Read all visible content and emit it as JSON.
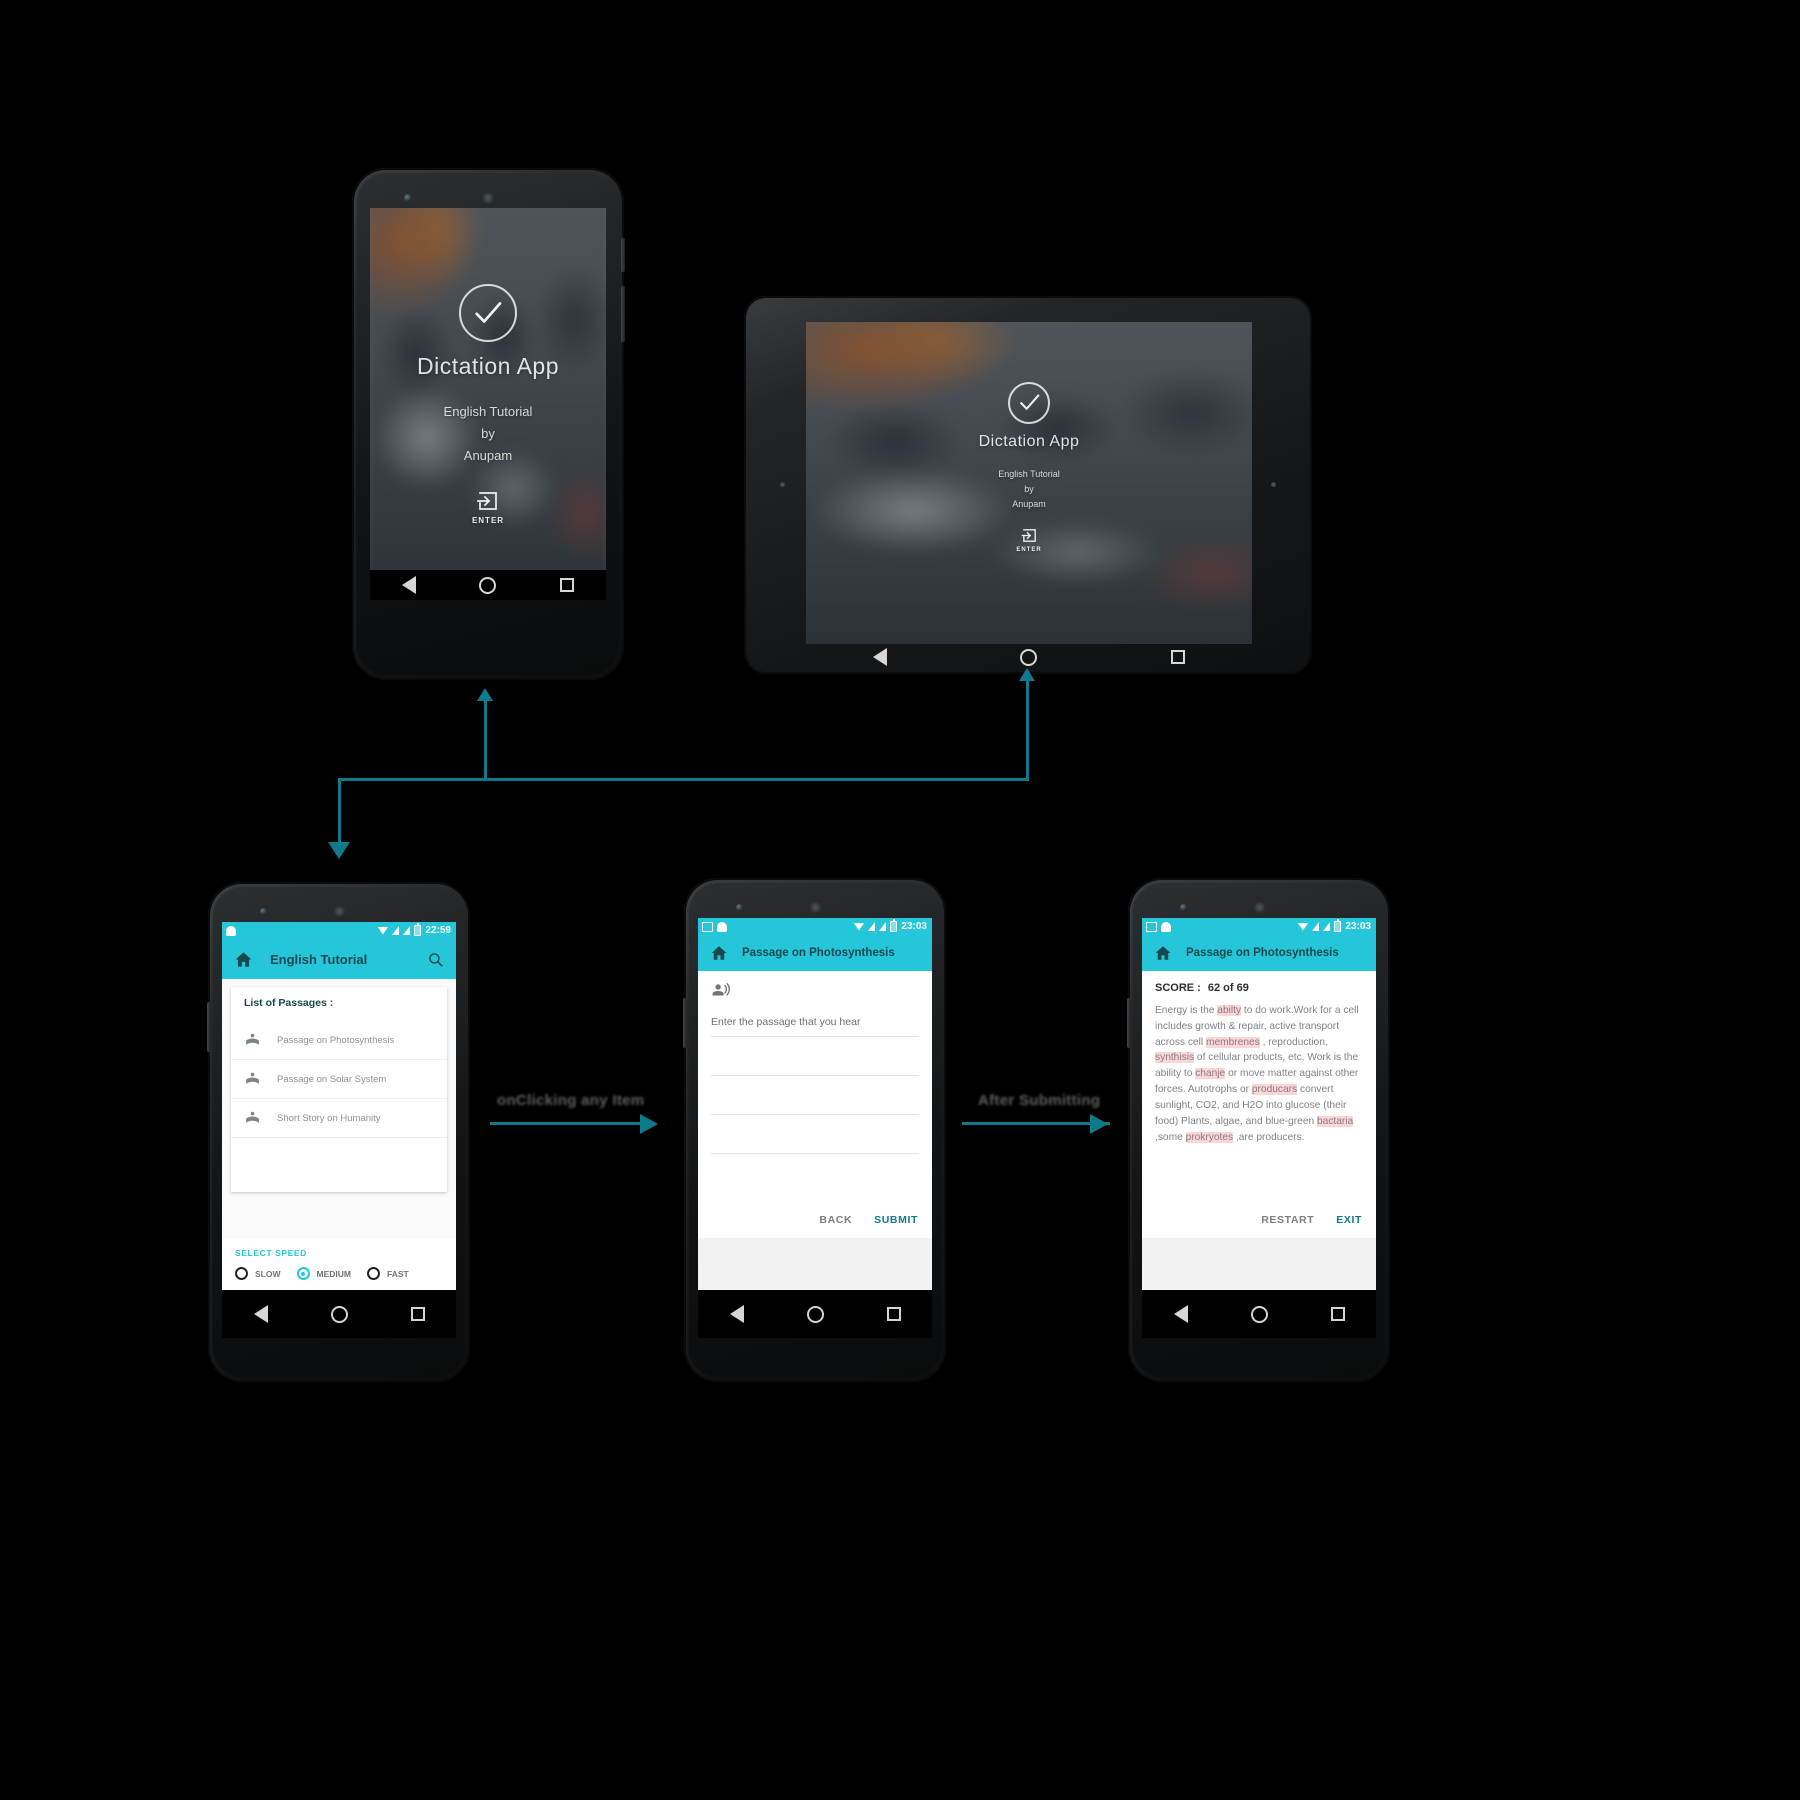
{
  "splash": {
    "app_title": "Dictation App",
    "line1": "English Tutorial",
    "line2": "by",
    "line3": "Anupam",
    "enter_label": "ENTER",
    "check_icon": "check-icon",
    "enter_icon": "exit-to-app-icon"
  },
  "list_screen": {
    "status_time": "22:59",
    "appbar_title": "English Tutorial",
    "home_icon": "home-icon",
    "search_icon": "search-icon",
    "list_header": "List of Passages :",
    "items": [
      {
        "label": "Passage on Photosynthesis",
        "icon": "local-library-icon"
      },
      {
        "label": "Passage on Solar System",
        "icon": "local-library-icon"
      },
      {
        "label": "Short Story on Humanity",
        "icon": "local-library-icon"
      }
    ],
    "speed_label": "SELECT SPEED",
    "speed_options": [
      {
        "label": "SLOW",
        "selected": false
      },
      {
        "label": "MEDIUM",
        "selected": true
      },
      {
        "label": "FAST",
        "selected": false
      }
    ]
  },
  "input_screen": {
    "status_time": "23:03",
    "appbar_title": "Passage on Photosynthesis",
    "home_icon": "home-icon",
    "speaker_icon": "record-voice-over-icon",
    "input_placeholder": "Enter the passage that you hear",
    "input_value": "",
    "back_label": "BACK",
    "submit_label": "SUBMIT"
  },
  "result_screen": {
    "status_time": "23:03",
    "appbar_title": "Passage on Photosynthesis",
    "home_icon": "home-icon",
    "score_label": "SCORE :",
    "score_value": "62 of 69",
    "passage_parts": [
      {
        "t": "Energy is the ",
        "err": false
      },
      {
        "t": "abilty",
        "err": true
      },
      {
        "t": " to do work.Work for a cell includes growth & repair, active transport across cell ",
        "err": false
      },
      {
        "t": "membrenes",
        "err": true
      },
      {
        "t": " , reproduction, ",
        "err": false
      },
      {
        "t": "synthisis",
        "err": true
      },
      {
        "t": " of cellular products, etc. Work is the ability to ",
        "err": false
      },
      {
        "t": "chanje",
        "err": true
      },
      {
        "t": " or move matter against other forces. Autotrophs or ",
        "err": false
      },
      {
        "t": "producars",
        "err": true
      },
      {
        "t": " convert sunlight, CO2, and H2O into glucose (their food) Plants, algae, and blue-green ",
        "err": false
      },
      {
        "t": "bactaria",
        "err": true
      },
      {
        "t": " ,some ",
        "err": false
      },
      {
        "t": "prokryotes",
        "err": true
      },
      {
        "t": " ,are producers.",
        "err": false
      }
    ],
    "restart_label": "RESTART",
    "exit_label": "EXIT"
  },
  "connectors": {
    "label_click": "onClicking any Item",
    "label_submit": "After Submitting",
    "accent": "#0e7b8c"
  },
  "theme": {
    "primary": "#26C6DA",
    "title_dark": "#17494f",
    "error_highlight": "#FAD6D8"
  }
}
